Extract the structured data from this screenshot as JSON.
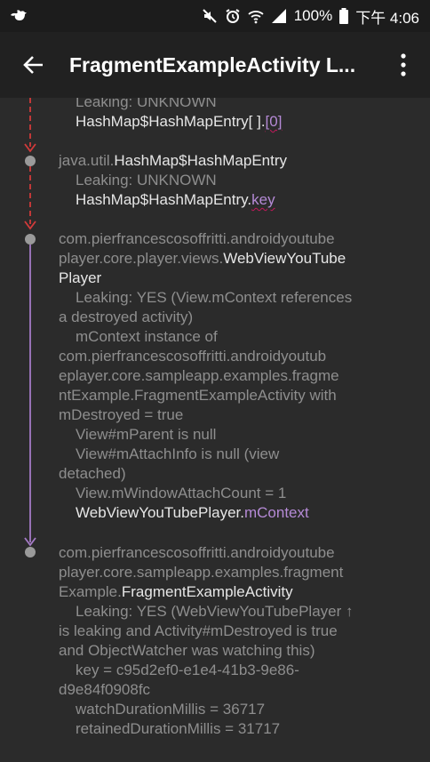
{
  "status_bar": {
    "battery": "100%",
    "time": "下午 4:06"
  },
  "toolbar": {
    "title": "FragmentExampleActivity L..."
  },
  "trace": {
    "block1": {
      "leaking": "Leaking: UNKNOWN",
      "ref_class": "HashMap$HashMapEntry[ ].",
      "ref_field": "[0]"
    },
    "block2": {
      "pkg": "java.util.",
      "cls": "HashMap$HashMapEntry",
      "leaking": "Leaking: UNKNOWN",
      "ref_class": "HashMap$HashMapEntry.",
      "ref_field": "key"
    },
    "block3": {
      "pkg1": "com.pierfrancescosoffritti.androidyoutube",
      "pkg2": "player.core.player.views.",
      "cls_a": "WebViewYouTube",
      "cls_b": "Player",
      "leak1": "Leaking: YES (View.mContext references",
      "leak2": "a destroyed activity)",
      "ctx1": "mContext instance of",
      "ctx2": "com.pierfrancescosoffritti.androidyoutub",
      "ctx3": "eplayer.core.sampleapp.examples.fragme",
      "ctx4": "ntExample.FragmentExampleActivity with",
      "ctx5": "mDestroyed = true",
      "parent": "View#mParent is null",
      "attach1": "View#mAttachInfo is null (view",
      "attach2": "detached)",
      "count": "View.mWindowAttachCount = 1",
      "ref_class": "WebViewYouTubePlayer.",
      "ref_field": "mContext"
    },
    "block4": {
      "pkg1": "com.pierfrancescosoffritti.androidyoutube",
      "pkg2": "player.core.sampleapp.examples.fragment",
      "pkg3": "Example.",
      "cls": "FragmentExampleActivity",
      "leak1": "Leaking: YES (WebViewYouTubePlayer ↑",
      "leak2": "is leaking and Activity#mDestroyed is true",
      "leak3": "and ObjectWatcher was watching this)",
      "key1": "key = c95d2ef0-e1e4-41b3-9e86-",
      "key2": "d9e84f0908fc",
      "watch": "watchDurationMillis = 36717",
      "retained": "retainedDurationMillis = 31717"
    }
  },
  "colors": {
    "background": "#2b2b2b",
    "toolbar": "#212121",
    "status_bar": "#1c1c1c",
    "dashed_arrow": "#d23a3a",
    "solid_arrow": "#a57bc6",
    "node": "#9a9a9a",
    "reference": "#b58ad6"
  }
}
